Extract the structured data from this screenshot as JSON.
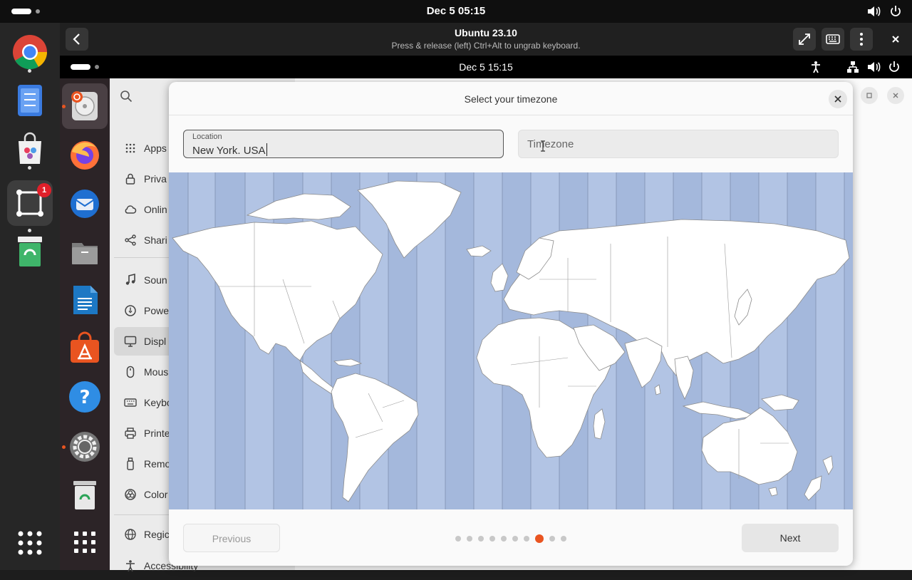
{
  "host": {
    "clock": "Dec 5  05:15",
    "dock": [
      {
        "name": "chrome"
      },
      {
        "name": "text-editor"
      },
      {
        "name": "app-center"
      },
      {
        "name": "remote-desktop",
        "badge": "1"
      },
      {
        "name": "trash"
      }
    ]
  },
  "vm": {
    "title": "Ubuntu 23.10",
    "subtitle": "Press & release (left) Ctrl+Alt to ungrab keyboard."
  },
  "guest": {
    "clock": "Dec 5  15:15",
    "dock": [
      "installer",
      "firefox",
      "thunderbird",
      "files",
      "writer",
      "app-center",
      "help",
      "settings",
      "trash",
      "show-apps"
    ]
  },
  "settings_sidebar": {
    "items": [
      {
        "label": "Apps",
        "icon": "grid-icon"
      },
      {
        "label": "Priva",
        "icon": "lock-icon"
      },
      {
        "label": "Onlin",
        "icon": "cloud-icon"
      },
      {
        "label": "Shari",
        "icon": "share-icon"
      },
      {
        "label": "Soun",
        "icon": "music-note-icon"
      },
      {
        "label": "Powe",
        "icon": "power-icon"
      },
      {
        "label": "Displ",
        "icon": "monitor-icon",
        "selected": true
      },
      {
        "label": "Mous",
        "icon": "mouse-icon"
      },
      {
        "label": "Keybo",
        "icon": "keyboard-icon"
      },
      {
        "label": "Printe",
        "icon": "printer-icon"
      },
      {
        "label": "Remo",
        "icon": "removable-media-icon"
      },
      {
        "label": "Color",
        "icon": "color-icon"
      },
      {
        "label": "Regic",
        "icon": "globe-icon"
      },
      {
        "label": "Accessibility",
        "icon": "accessibility-icon"
      }
    ]
  },
  "dialog": {
    "title": "Select your timezone",
    "location_label": "Location",
    "location_value": "New York. USA",
    "timezone_placeholder": "Timezone",
    "previous_label": "Previous",
    "next_label": "Next",
    "page_count": 10,
    "current_page": 8
  },
  "colors": {
    "accent": "#e95420",
    "ocean": "#a4b8dc",
    "land": "#ffffff"
  }
}
